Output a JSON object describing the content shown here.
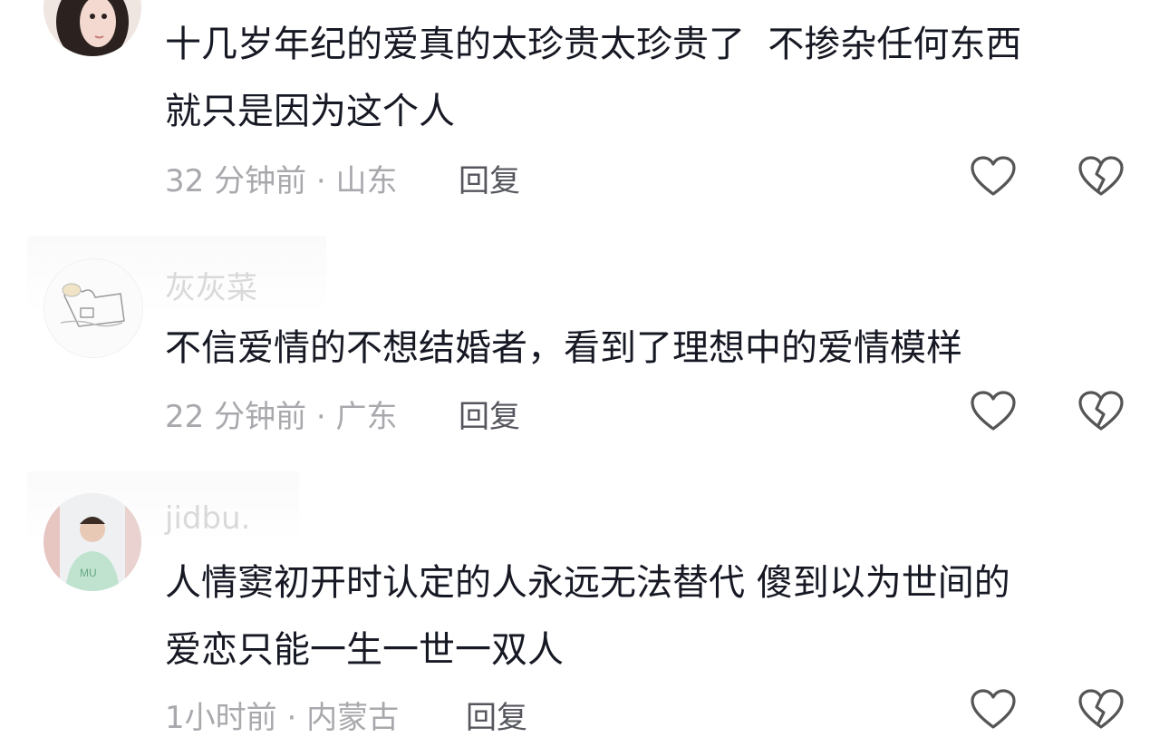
{
  "comments": [
    {
      "username": "",
      "text": "十几岁年纪的爱真的太珍贵太珍贵了  不掺杂任何东西\n就只是因为这个人",
      "time": "32 分钟前",
      "location": "山东",
      "reply_label": "回复"
    },
    {
      "username": "灰灰菜",
      "text": "不信爱情的不想结婚者，看到了理想中的爱情模样",
      "time": "22 分钟前",
      "location": "广东",
      "reply_label": "回复"
    },
    {
      "username": "jidbu.",
      "text": "人情窦初开时认定的人永远无法替代 傻到以为世间的\n爱恋只能一生一世一双人",
      "time": "1小时前",
      "location": "内蒙古",
      "reply_label": "回复"
    }
  ],
  "separator": " · ",
  "icons": {
    "like": "heart-outline-icon",
    "dislike": "broken-heart-outline-icon"
  },
  "colors": {
    "text": "#161823",
    "meta": "#a8a8ad",
    "reply": "#55565e",
    "username": "#d9d9d9",
    "icon": "#555555"
  }
}
